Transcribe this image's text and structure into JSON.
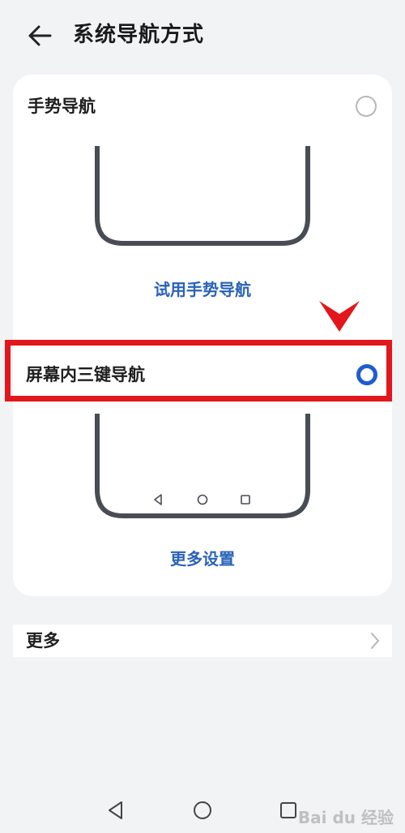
{
  "header": {
    "title": "系统导航方式",
    "back_icon": "arrow-left-icon"
  },
  "options": [
    {
      "label": "手势导航",
      "selected": false,
      "link": "试用手势导航"
    },
    {
      "label": "屏幕内三键导航",
      "selected": true,
      "link": "更多设置"
    }
  ],
  "more": {
    "label": "更多",
    "icon": "chevron-right-icon"
  },
  "system_nav": {
    "back_icon": "triangle-back-icon",
    "home_icon": "circle-home-icon",
    "recents_icon": "square-recents-icon"
  },
  "watermark": {
    "text": "Bai du 经验"
  },
  "colors": {
    "accent": "#1f5cd1",
    "link": "#2a63b8",
    "highlight": "#e3161c",
    "background": "#f1f3f5",
    "phone_outline": "#484c55"
  }
}
